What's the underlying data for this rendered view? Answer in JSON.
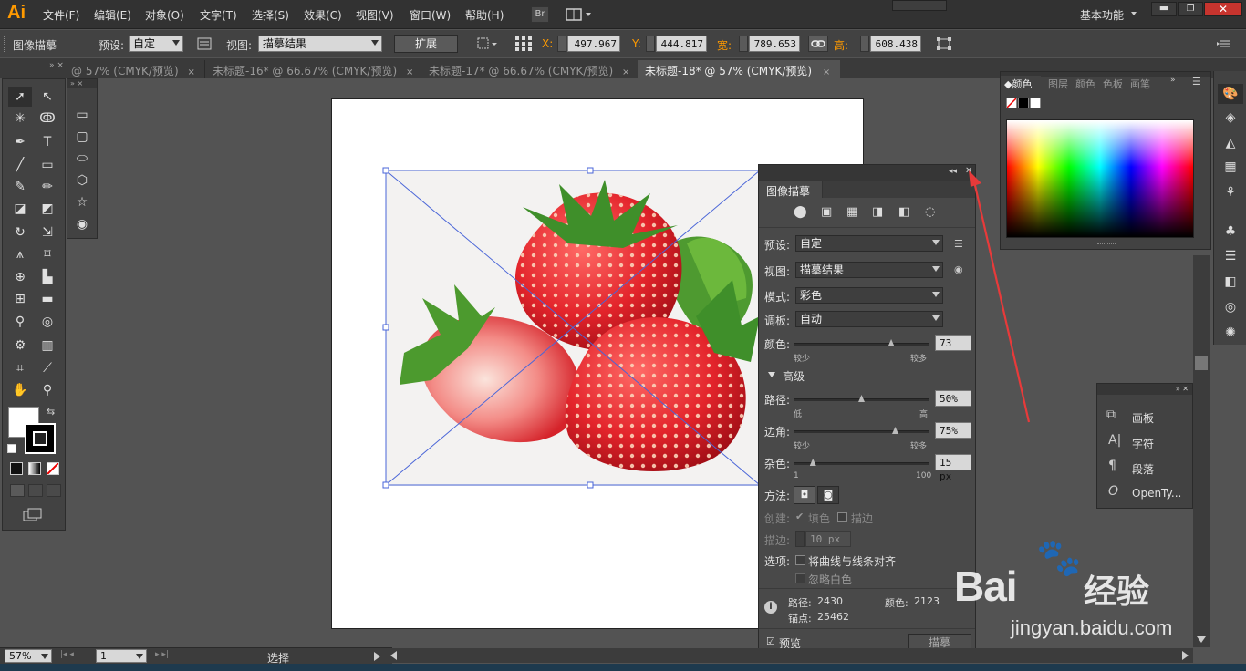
{
  "app": {
    "logo": "Ai",
    "workspace": "基本功能"
  },
  "menu": [
    "文件(F)",
    "编辑(E)",
    "对象(O)",
    "文字(T)",
    "选择(S)",
    "效果(C)",
    "视图(V)",
    "窗口(W)",
    "帮助(H)"
  ],
  "bridge": "Br",
  "control": {
    "panel_name": "图像描摹",
    "preset_label": "预设:",
    "preset_value": "自定",
    "view_label": "视图:",
    "view_value": "描摹结果",
    "expand_label": "扩展",
    "x_label": "X:",
    "x_value": "497.967",
    "y_label": "Y:",
    "y_value": "444.817",
    "w_label": "宽:",
    "w_value": "789.653",
    "h_label": "高:",
    "h_value": "608.438"
  },
  "tabs": [
    {
      "label": "@ 57% (CMYK/预览)",
      "close": "×"
    },
    {
      "label": "未标题-16* @ 66.67% (CMYK/预览)",
      "close": "×"
    },
    {
      "label": "未标题-17* @ 66.67% (CMYK/预览)",
      "close": "×"
    },
    {
      "label": "未标题-18* @ 57% (CMYK/预览)",
      "close": "×"
    }
  ],
  "trace": {
    "title": "图像描摹",
    "preset_label": "预设:",
    "preset_value": "自定",
    "view_label": "视图:",
    "view_value": "描摹结果",
    "mode_label": "模式:",
    "mode_value": "彩色",
    "palette_label": "调板:",
    "palette_value": "自动",
    "colors_label": "颜色:",
    "colors_value": "73",
    "colors_level": 0.72,
    "less": "较少",
    "more": "较多",
    "advanced": "高级",
    "paths_label": "路径:",
    "paths_value": "50%",
    "paths_level": 0.5,
    "low": "低",
    "high": "高",
    "corners_label": "边角:",
    "corners_value": "75%",
    "corners_level": 0.75,
    "noise_label": "杂色:",
    "noise_value": "15 px",
    "noise_level": 0.14,
    "noise_min": "1",
    "noise_max": "100",
    "method_label": "方法:",
    "create_label": "创建:",
    "fill_label": "填色",
    "stroke_label": "描边",
    "stroke_w_label": "描边:",
    "stroke_w_value": "10 px",
    "options_label": "选项:",
    "snap_label": "将曲线与线条对齐",
    "ignore_white_label": "忽略白色",
    "paths_count_label": "路径:",
    "paths_count": "2430",
    "colors_count_label": "颜色:",
    "colors_count": "2123",
    "anchors_label": "锚点:",
    "anchors_count": "25462",
    "preview_label": "预览",
    "trace_button": "描摹"
  },
  "colorPanel": {
    "tabs": [
      "颜色",
      "图层",
      "颜色",
      "色板",
      "画笔"
    ]
  },
  "charPanel": {
    "items": [
      "画板",
      "字符",
      "段落",
      "OpenTy..."
    ]
  },
  "status": {
    "zoom": "57%",
    "page": "1",
    "mode": "选择"
  },
  "watermark": {
    "brand": "Bai",
    "suffix": "经验",
    "url": "jingyan.baidu.com"
  },
  "colors": {
    "accent": "#ff9a00",
    "selection": "#4a66d8",
    "arrow": "#e83a3a"
  }
}
